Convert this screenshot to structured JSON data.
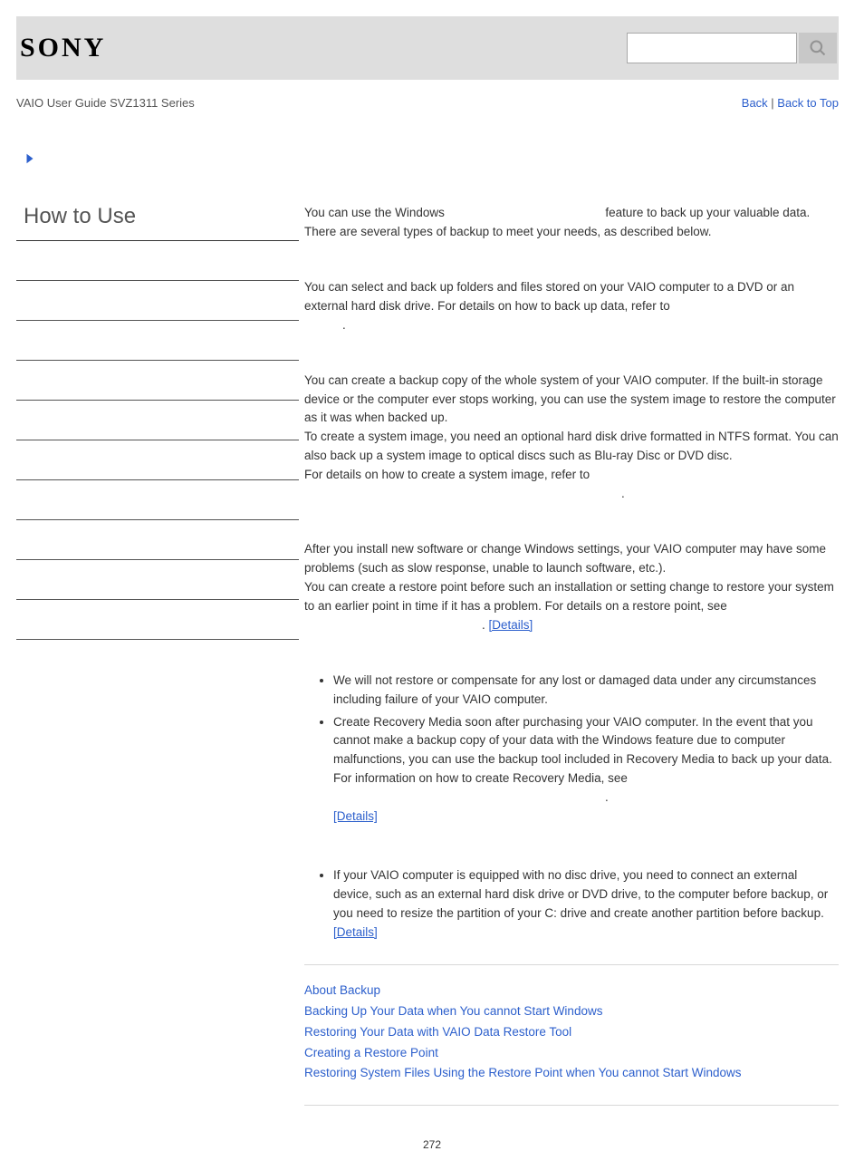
{
  "header": {
    "logo_text": "SONY",
    "search_placeholder": ""
  },
  "subheader": {
    "left": "VAIO User Guide SVZ1311 Series",
    "back": "Back",
    "sep": " | ",
    "top": "Back to Top"
  },
  "sidebar": {
    "title": "How to Use",
    "items": [
      "",
      "",
      "",
      "",
      "",
      "",
      "",
      "",
      "",
      ""
    ]
  },
  "content": {
    "intro1a": "You can use the Windows ",
    "intro1b": " feature to back up your valuable data.",
    "intro2": "There are several types of backup to meet your needs, as described below.",
    "sec1a": "You can select and back up folders and files stored on your VAIO computer to a DVD or an external hard disk drive. For details on how to back up data, refer to ",
    "sec1b": ".",
    "sec2p1": "You can create a backup copy of the whole system of your VAIO computer. If the built-in storage device or the computer ever stops working, you can use the system image to restore the computer as it was when backed up.",
    "sec2p2": "To create a system image, you need an optional hard disk drive formatted in NTFS format. You can also back up a system image to optical discs such as Blu-ray Disc or DVD disc.",
    "sec2p3a": "For details on how to create a system image, refer to ",
    "sec2p3b": ".",
    "sec3p1": "After you install new software or change Windows settings, your VAIO computer may have some problems (such as slow response, unable to launch software, etc.).",
    "sec3p2a": "You can create a restore point before such an installation or setting change to restore your system to an earlier point in time if it has a problem. For details on a restore point, see ",
    "sec3p2b": ". ",
    "details": "[Details]",
    "note_b1": "We will not restore or compensate for any lost or damaged data under any circumstances including failure of your VAIO computer.",
    "note_b2a": "Create Recovery Media soon after purchasing your VAIO computer. In the event that you cannot make a backup copy of your data with the Windows feature due to computer malfunctions, you can use the backup tool included in Recovery Media to back up your data.",
    "note_b2b": "For information on how to create Recovery Media, see ",
    "note_b2c": ".",
    "hint_b1a": "If your VAIO computer is equipped with no disc drive, you need to connect an external device, such as an external hard disk drive or DVD drive, to the computer before backup, or you need to resize the partition of your C: drive and create another partition before backup. ",
    "related": [
      "About Backup",
      "Backing Up Your Data when You cannot Start Windows",
      "Restoring Your Data with VAIO Data Restore Tool",
      "Creating a Restore Point",
      "Restoring System Files Using the Restore Point when You cannot Start Windows"
    ]
  },
  "page_number": "272"
}
